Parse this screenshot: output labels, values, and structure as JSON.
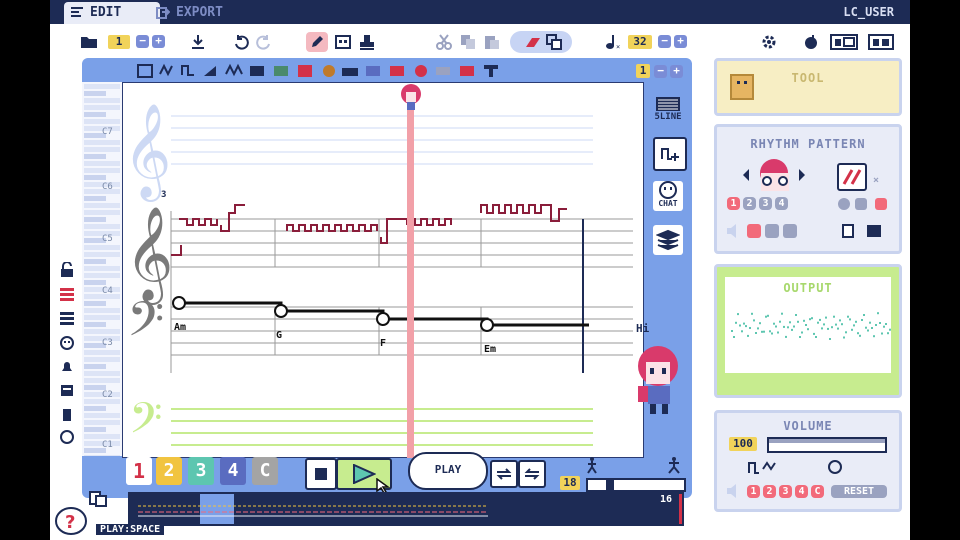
{
  "tabs": {
    "edit": "EDIT",
    "export": "EXPORT"
  },
  "user": "LC_USER",
  "toolbar": {
    "page_number": "1",
    "tempo": "32"
  },
  "instrument_toolbar": {
    "page": "1"
  },
  "side_tool": {
    "five_line": "5LINE",
    "chat": "CHAT"
  },
  "score": {
    "triplet_mark": "3",
    "octave_labels": [
      "C7",
      "C6",
      "C5",
      "C4",
      "C3",
      "C2",
      "C1"
    ]
  },
  "chords": [
    "Am",
    "G",
    "F",
    "Em"
  ],
  "instruments": [
    "1",
    "2",
    "3",
    "4",
    "C"
  ],
  "transport": {
    "play_tooltip": "PLAY",
    "bar": "18"
  },
  "timeline": {
    "end_bar": "16",
    "hint": "PLAY:SPACE"
  },
  "character_bubble": "Hi",
  "panels": {
    "tool": {
      "title": "TOOL"
    },
    "rhythm": {
      "title": "RHYTHM PATTERN",
      "numbers": [
        "1",
        "2",
        "3",
        "4"
      ]
    },
    "output": {
      "title": "OUTPUT"
    },
    "volume": {
      "title": "VOLUME",
      "value": "100",
      "channels": [
        "1",
        "2",
        "3",
        "4",
        "C"
      ],
      "reset": "RESET"
    }
  },
  "colors": {
    "navy": "#1d2b55",
    "blue": "#7aa0e8",
    "red_note": "#8a1d3a",
    "playhead": "#f2a0a8",
    "yellow": "#f1d35a",
    "green": "#c7ec8f",
    "ch1": "#f26a7a",
    "ch2": "#f1c440",
    "ch3": "#5dc6b0",
    "ch4": "#5a6cc0",
    "chC": "#a4a4a4"
  }
}
